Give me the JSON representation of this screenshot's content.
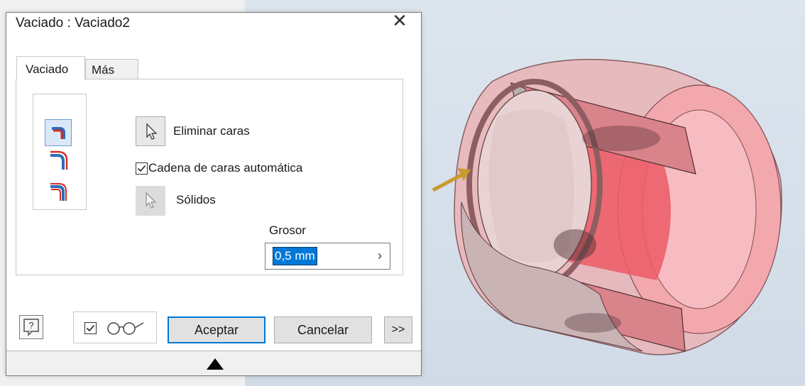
{
  "dialog": {
    "title": "Vaciado : Vaciado2",
    "close_glyph": "✕",
    "tabs": [
      {
        "label": "Vaciado",
        "active": true
      },
      {
        "label": "Más",
        "active": false
      }
    ]
  },
  "mode_buttons": [
    {
      "icon": "shell-inside-icon",
      "selected": true
    },
    {
      "icon": "shell-outside-icon",
      "selected": false
    },
    {
      "icon": "shell-both-sides-icon",
      "selected": false
    }
  ],
  "eliminar": {
    "label": "Eliminar caras",
    "icon": "select-arrow-icon"
  },
  "cadena": {
    "label": "Cadena de caras automática",
    "checked": true
  },
  "solidos": {
    "label": "Sólidos",
    "icon": "select-arrow-disabled-icon"
  },
  "grosor": {
    "label": "Grosor",
    "value": "0,5 mm",
    "arrow": "›"
  },
  "footer": {
    "help_icon": "help-icon",
    "preview_checked": true,
    "preview_icon": "glasses-icon",
    "accept_label": "Aceptar",
    "cancel_label": "Cancelar",
    "more_label": ">>",
    "collapse_icon": "triangle-up-icon"
  },
  "colors": {
    "accent": "#0078d7",
    "viewport_bg": "#d6dfe9",
    "model_red": "#e8636d",
    "arrow_gold": "#c99a2e"
  }
}
